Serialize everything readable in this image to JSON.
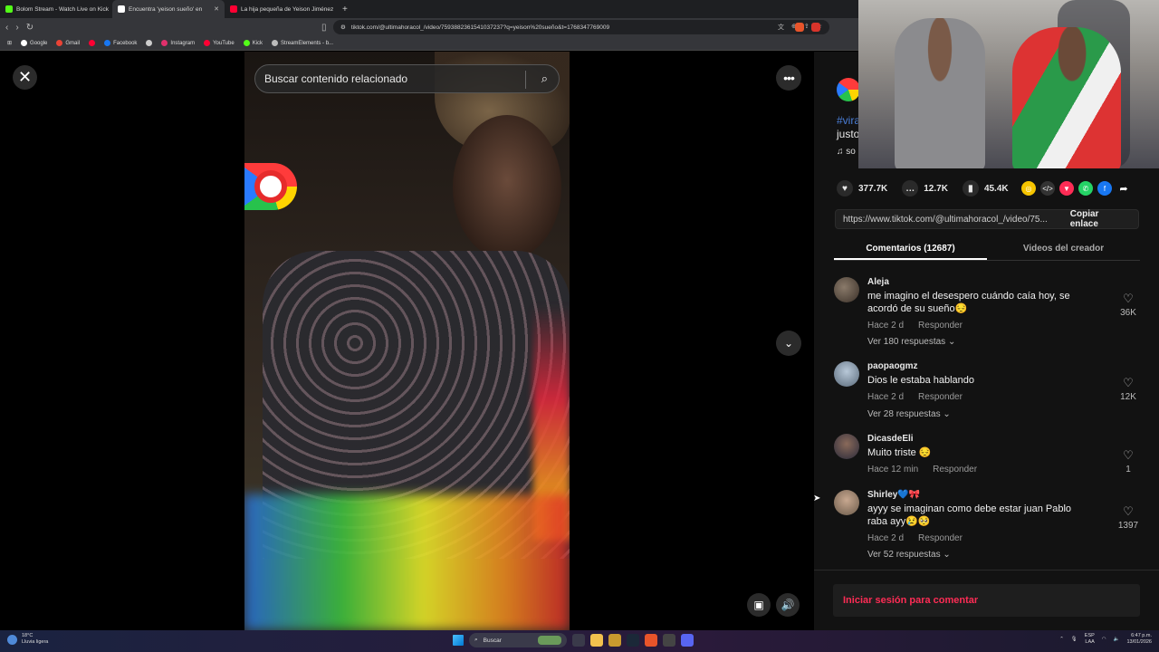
{
  "browser": {
    "tabs": [
      {
        "label": "Bolom Stream - Watch Live on Kick",
        "color": "#53fc18",
        "active": false
      },
      {
        "label": "Encuentra 'yeison sueño' en",
        "color": "#ffffff",
        "active": true
      },
      {
        "label": "La hija pequeña de Yeison Jiménez",
        "color": "#ff0033",
        "active": false
      }
    ],
    "new_tab": "+",
    "url": "tiktok.com/@ultimahoracol_/video/7593882361541037237?q=yeison%20sueño&t=1768347769009",
    "bookmarks": [
      "Google",
      "Gmail",
      "Facebook",
      "Instagram",
      "YouTube",
      "Kick",
      "StreamElements - b..."
    ]
  },
  "video": {
    "search_placeholder": "Buscar contenido relacionado"
  },
  "description": {
    "hashtag": "#vira",
    "text": "justo",
    "music": "♫ so"
  },
  "actions": {
    "likes": "377.7K",
    "comments": "12.7K",
    "saves": "45.4K"
  },
  "link": {
    "url": "https://www.tiktok.com/@ultimahoracol_/video/75...",
    "copy_label": "Copiar enlace"
  },
  "panel_tabs": [
    "Comentarios (12687)",
    "Videos del creador"
  ],
  "comments": [
    {
      "user": "Aleja",
      "text": "me imagino el desespero cuándo caía hoy, se acordó de su sueño😔",
      "time": "Hace 2 d",
      "reply": "Responder",
      "replies": "Ver 180 respuestas ⌄",
      "likes": "36K"
    },
    {
      "user": "paopaogmz",
      "text": "Dios le estaba hablando",
      "time": "Hace 2 d",
      "reply": "Responder",
      "replies": "Ver 28 respuestas ⌄",
      "likes": "12K"
    },
    {
      "user": "DicasdeEli",
      "text": "Muito triste 😔",
      "time": "Hace 12 min",
      "reply": "Responder",
      "replies": "",
      "likes": "1"
    },
    {
      "user": "Shirley💙🎀",
      "text": "ayyy se imaginan como debe estar juan Pablo raba ayy😢🥺",
      "time": "Hace 2 d",
      "reply": "Responder",
      "replies": "Ver 52 respuestas ⌄",
      "likes": "1397"
    }
  ],
  "login_label": "Iniciar sesión para comentar",
  "taskbar": {
    "temp": "18°C",
    "weather": "Lluvia ligera",
    "search": "Buscar",
    "lang": "ESP",
    "lang2": "LAA",
    "time": "6:47 p.m.",
    "date": "13/01/2026"
  }
}
